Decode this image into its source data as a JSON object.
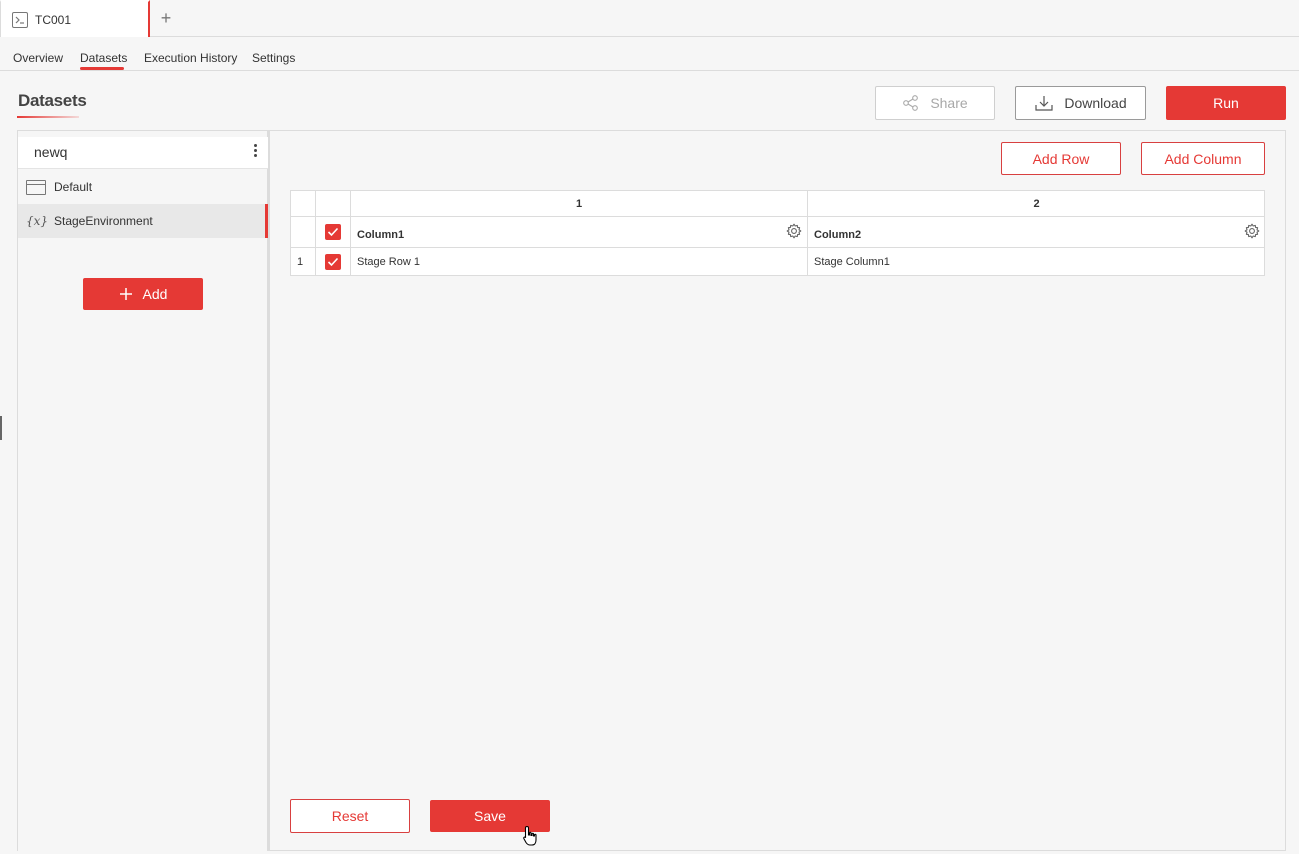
{
  "file_tab": {
    "label": "TC001",
    "new_tab_symbol": "+"
  },
  "nav": {
    "tabs": [
      "Overview",
      "Datasets",
      "Execution History",
      "Settings"
    ],
    "active": "Datasets"
  },
  "page": {
    "title": "Datasets"
  },
  "header_actions": {
    "share": "Share",
    "download": "Download",
    "run": "Run"
  },
  "dataset_panel": {
    "name": "newq",
    "items": [
      {
        "label": "Default",
        "icon": "window-icon"
      },
      {
        "label": "StageEnvironment",
        "icon": "variable-icon",
        "selected": true
      }
    ],
    "add_label": "Add"
  },
  "grid_actions": {
    "add_row": "Add Row",
    "add_column": "Add Column"
  },
  "table": {
    "column_numbers": [
      "1",
      "2"
    ],
    "headers": [
      "Column1",
      "Column2"
    ],
    "rows": [
      {
        "index": "1",
        "checked": true,
        "cells": [
          "Stage Row 1",
          "Stage Column1"
        ]
      }
    ]
  },
  "footer_actions": {
    "reset": "Reset",
    "save": "Save"
  },
  "colors": {
    "accent": "#e53935",
    "border": "#dcdcdc",
    "background": "#f6f6f6"
  }
}
